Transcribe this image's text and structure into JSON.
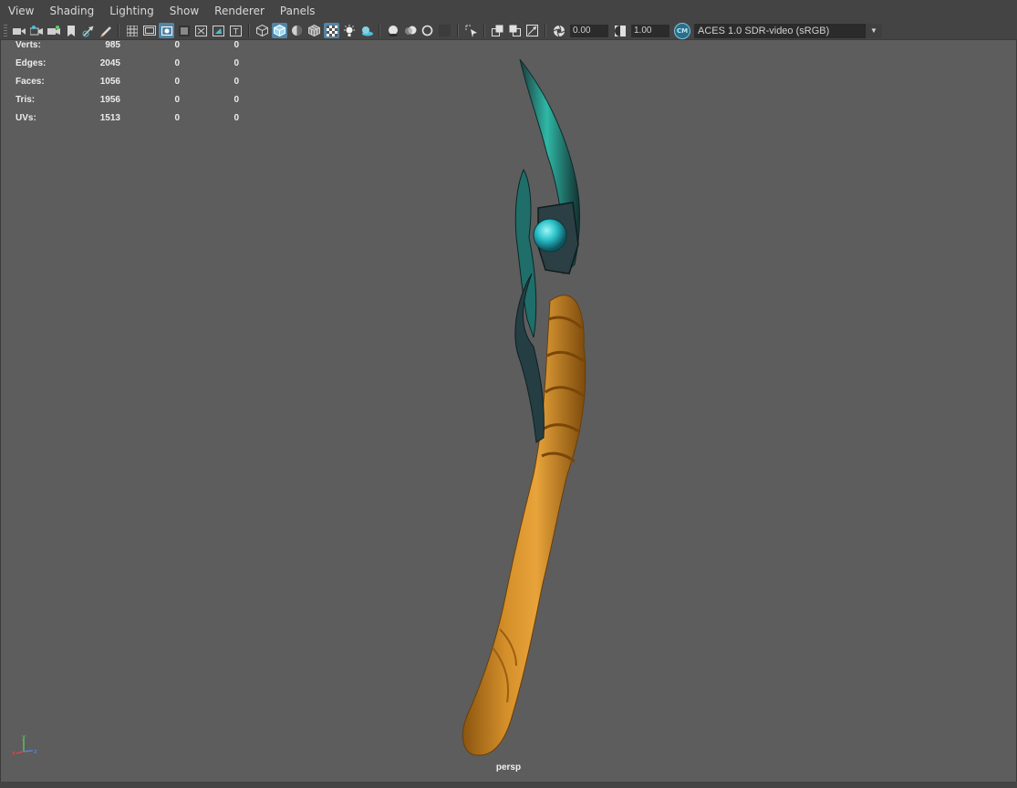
{
  "menu": {
    "items": [
      "View",
      "Shading",
      "Lighting",
      "Show",
      "Renderer",
      "Panels"
    ]
  },
  "toolbar": {
    "exposure_value": "0.00",
    "gamma_value": "1.00",
    "color_mgmt_badge": "CM",
    "view_transform": "ACES 1.0 SDR-video (sRGB)",
    "icons": {
      "group1": [
        "select-camera-icon",
        "camera-attributes-icon",
        "bookmarks-icon",
        "image-plane-icon",
        "2d-pan-zoom-icon",
        "grease-pencil-icon"
      ],
      "group2": [
        "grid-icon",
        "film-gate-icon",
        "resolution-gate-icon",
        "gate-mask-icon",
        "field-chart-icon",
        "safe-action-icon",
        "safe-title-icon"
      ],
      "group3": [
        "wireframe-icon",
        "smooth-shade-icon",
        "default-material-icon",
        "wireframe-on-shaded-icon",
        "textured-icon",
        "use-all-lights-icon",
        "shadows-icon"
      ],
      "group4": [
        "screen-space-ao-icon",
        "motion-blur-icon",
        "anti-aliasing-icon",
        "depth-of-field-icon"
      ],
      "group5": [
        "isolate-select-icon"
      ],
      "group6": [
        "xray-icon",
        "xray-active-components-icon",
        "xray-joints-icon"
      ]
    }
  },
  "hud": {
    "rows": [
      {
        "label": "Verts:",
        "v1": "985",
        "v2": "0",
        "v3": "0"
      },
      {
        "label": "Edges:",
        "v1": "2045",
        "v2": "0",
        "v3": "0"
      },
      {
        "label": "Faces:",
        "v1": "1056",
        "v2": "0",
        "v3": "0"
      },
      {
        "label": "Tris:",
        "v1": "1956",
        "v2": "0",
        "v3": "0"
      },
      {
        "label": "UVs:",
        "v1": "1513",
        "v2": "0",
        "v3": "0"
      }
    ]
  },
  "viewport": {
    "camera_name": "persp",
    "background_color": "#5d5d5d",
    "axis_labels": [
      "y",
      "x",
      "z"
    ],
    "axis_colors": {
      "x": "#e04848",
      "y": "#5bd45b",
      "z": "#5b8ae0"
    }
  }
}
